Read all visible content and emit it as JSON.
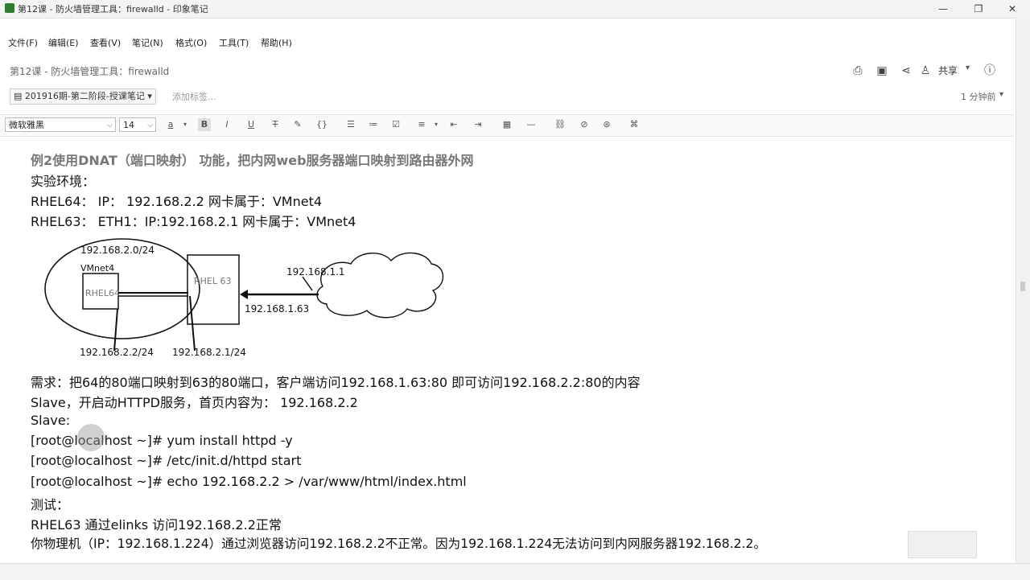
{
  "window": {
    "title": "第12课 - 防火墙管理工具：firewalld - 印象笔记",
    "controls": {
      "minimize": "—",
      "maximize": "❐",
      "close": "✕"
    }
  },
  "menu": [
    "文件(F)",
    "编辑(E)",
    "查看(V)",
    "笔记(N)",
    "格式(O)",
    "工具(T)",
    "帮助(H)"
  ],
  "note": {
    "title": "第12课 - 防火墙管理工具：firewalld",
    "share_label": "共享",
    "notebook": "201916期-第二阶段-授课笔记",
    "add_tag_placeholder": "添加标签...",
    "last_edit": "1 分钟前"
  },
  "format_bar": {
    "font": "微软雅黑",
    "size": "14"
  },
  "doc": {
    "heading": "例2使用DNAT（端口映射） 功能，把内网web服务器端口映射到路由器外网",
    "lines_top": [
      "实验环境：",
      "RHEL64： IP： 192.168.2.2          网卡属于：VMnet4",
      "RHEL63：  ETH1：IP:192.168.2.1       网卡属于：VMnet4"
    ],
    "diagram": {
      "subnet": "192.168.2.0/24",
      "vmnet": "VMnet4",
      "host64": "RHEL64",
      "host63": "RHEL 63",
      "cloud_ip": "192.168.1.1",
      "ext_ip": "192.168.1.63",
      "ip_64": "192.168.2.2/24",
      "ip_63": "192.168.2.1/24"
    },
    "lines_bottom": [
      "需求：把64的80端口映射到63的80端口，客户端访问192.168.1.63:80 即可访问192.168.2.2:80的内容",
      "Slave，开启动HTTPD服务，首页内容为： 192.168.2.2",
      "Slave:",
      "[root@localhost ~]# yum install httpd -y",
      "[root@localhost ~]# /etc/init.d/httpd start",
      "[root@localhost ~]# echo 192.168.2.2 > /var/www/html/index.html",
      "测试：",
      "RHEL63 通过elinks  访问192.168.2.2正常",
      "你物理机（IP：192.168.1.224）通过浏览器访问192.168.2.2不正常。因为192.168.1.224无法访问到内网服务器192.168.2.2。"
    ]
  }
}
